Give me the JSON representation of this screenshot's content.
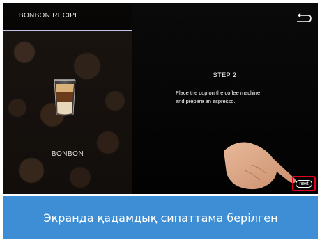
{
  "recipe_header": {
    "title": "BONBON RECIPE"
  },
  "product": {
    "name": "BONBON"
  },
  "step": {
    "title": "STEP 2",
    "instruction_line1": "Place the cup on the coffee machine",
    "instruction_line2": "and prepare an espresso."
  },
  "navigation": {
    "next_label": "next",
    "back_icon": "back-arrow-icon"
  },
  "caption": {
    "text": "Экранда қадамдық сипаттама берілген"
  },
  "colors": {
    "accent_underline": "#c9c2e6",
    "highlight_border": "#e3001b",
    "caption_bg": "#3e8ed6",
    "screen_bg": "#050505"
  }
}
